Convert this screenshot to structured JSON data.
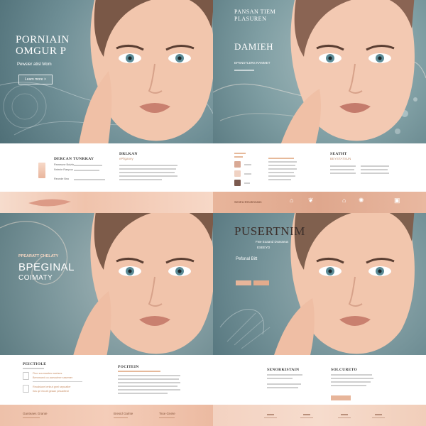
{
  "panels": {
    "p1": {
      "hero_title": "PORNIAIN",
      "hero_title2": "OMGUR P",
      "hero_sub": "Pewsler atisl  Mom",
      "hero_button": "Learn more  >",
      "col1_title": "DERCAN TUNRKAY",
      "col2_title": "DRLKAN",
      "col2_sub": "ePliganey",
      "product_lines": [
        "Parneune Bolzfo",
        "Nntrnie Ranpoa",
        "Reunde Bno"
      ]
    },
    "p2": {
      "hero_title": "PANSAN TIEM",
      "hero_title2": "PLASUREN",
      "hero_title3": "DAMIEH",
      "hero_sub": "EPSNSTLERS RAMMET",
      "col1_title": "SEATHT",
      "col1_sub": "BEYSTATSUN",
      "footer_text": "Sentra Dmotmnass"
    },
    "p3": {
      "hero_kicker": "PPEARATT CHELATY",
      "hero_title": "BPEGINAL",
      "hero_title2": "COIMATY",
      "col1_title": "PEICTIOLE",
      "col1_lines": [
        "Fine soumaetes naeiaes",
        "Bennnued ou aoeoutner sssemer",
        "Reudsiure ienbut gnel sepuatler",
        "Ilos qe ntouti geaan pesadtest"
      ],
      "col2_title": "POCITEIN",
      "footer_items": [
        "Ganteaes Grante",
        "Bresid Galnte",
        "Tsse Gnete"
      ]
    },
    "p4": {
      "hero_title": "PUSERTNIM",
      "hero_title2": "ESEEYD",
      "hero_sub": "Fwe Eoaand Dvasseus",
      "hero_line": "Pefsnal Bitt",
      "col1_title": "SENORKISTAIN",
      "col2_title": "SOLCURETO"
    }
  },
  "colors": {
    "teal": "#6f8f96",
    "peach": "#e7b59a",
    "skin": "#f2c6ad"
  }
}
